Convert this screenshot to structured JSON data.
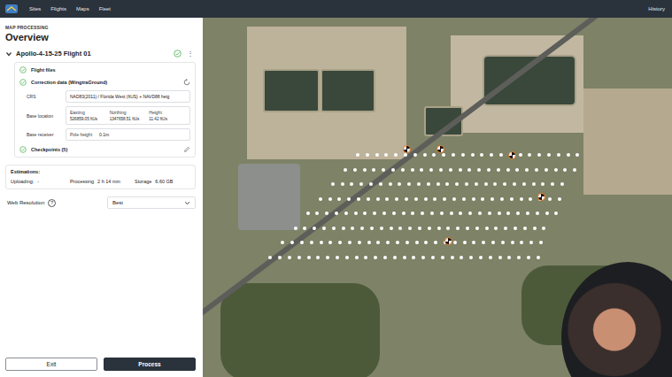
{
  "nav": {
    "items": [
      {
        "label": "Sites",
        "selected": false
      },
      {
        "label": "Flights",
        "selected": false
      },
      {
        "label": "Maps",
        "selected": false
      },
      {
        "label": "Fleet",
        "selected": false
      }
    ],
    "right": "History"
  },
  "panel": {
    "eyebrow": "MAP PROCESSING",
    "title": "Overview"
  },
  "flight": {
    "name": "Apollo-4-15-25 Flight 01",
    "expanded": true,
    "done": true,
    "menu_icon": "⋮"
  },
  "steps": [
    {
      "label": "Flight files",
      "done": true,
      "loading": false,
      "kind": "plain"
    },
    {
      "label": "Correction data (WingtraGround)",
      "done": true,
      "loading": true,
      "kind": "correction"
    },
    {
      "label": "Checkpoints (5)",
      "done": true,
      "loading": false,
      "kind": "editable"
    }
  ],
  "correction": {
    "crs": {
      "label": "CRS",
      "value": "NAD83(2011) / Florida West (ftUS) + NAVD88 heig"
    },
    "base_location": {
      "label": "Base location",
      "fields": [
        {
          "label": "Easting",
          "value": "526859.05",
          "unit": "ftUs"
        },
        {
          "label": "Northing",
          "value": "1347658.51",
          "unit": "ftUs"
        },
        {
          "label": "Height",
          "value": "11.42",
          "unit": "ftUs"
        }
      ]
    },
    "base_receiver": {
      "label": "Base receiver",
      "field_label": "Pole height",
      "value": "0.1m"
    }
  },
  "estimations": {
    "title": "Estimations:",
    "items": [
      {
        "label": "Uploading:",
        "value": "-"
      },
      {
        "label": "Processing",
        "value": "2 h 14 min"
      },
      {
        "label": "Storage",
        "value": "6.60 GB"
      }
    ]
  },
  "web_resolution": {
    "label": "Web Resolution",
    "info_icon": "?",
    "value": "Best"
  },
  "buttons": [
    {
      "label": "Exit",
      "kind": "secondary"
    },
    {
      "label": "Process",
      "kind": "primary"
    }
  ]
}
